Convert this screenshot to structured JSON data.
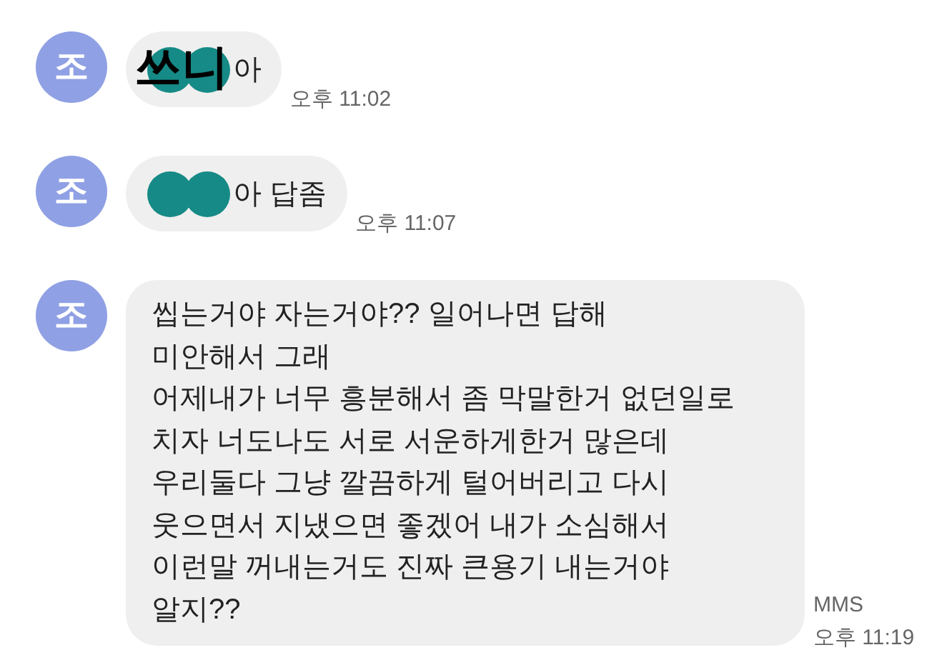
{
  "messages": [
    {
      "avatar": "조",
      "redacted": true,
      "annotation": "쓰니",
      "text": "아",
      "time": "오후 11:02"
    },
    {
      "avatar": "조",
      "redacted": true,
      "text": "아 답좀",
      "time": "오후 11:07"
    },
    {
      "avatar": "조",
      "redacted": false,
      "text": "씹는거야 자는거야?? 일어나면 답해\n미안해서 그래\n어제내가 너무 흥분해서 좀 막말한거 없던일로\n치자 너도나도 서로 서운하게한거 많은데\n우리둘다 그냥 깔끔하게 털어버리고 다시\n웃으면서 지냈으면 좋겠어 내가 소심해서\n이런말 꺼내는거도 진짜 큰용기 내는거야\n알지??",
      "type_label": "MMS",
      "time": "오후 11:19"
    }
  ]
}
